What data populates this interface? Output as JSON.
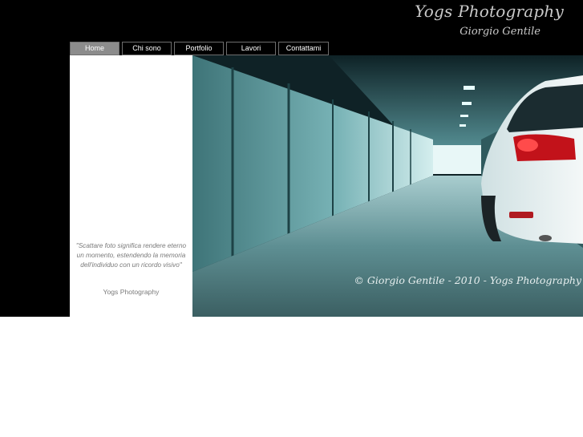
{
  "brand": {
    "title": "Yogs Photography",
    "subtitle": "Giorgio Gentile"
  },
  "nav": {
    "items": [
      {
        "label": "Home",
        "active": true
      },
      {
        "label": "Chi sono",
        "active": false
      },
      {
        "label": "Portfolio",
        "active": false
      },
      {
        "label": "Lavori",
        "active": false
      },
      {
        "label": "Contattami",
        "active": false
      }
    ]
  },
  "sidebar": {
    "quote": "\"Scattare foto significa rendere eterno un momento, estendendo la memoria dell'individuo con un ricordo visivo\"",
    "author": "Yogs Photography"
  },
  "hero": {
    "image": "garage-corridor-car-photo",
    "caption": "© Giorgio Gentile - 2010 - Yogs Photography"
  },
  "colors": {
    "background": "#000000",
    "nav_active": "#8c8c8c",
    "text_muted": "#7a7a7a",
    "accent_teal": "#4fa3a8"
  }
}
